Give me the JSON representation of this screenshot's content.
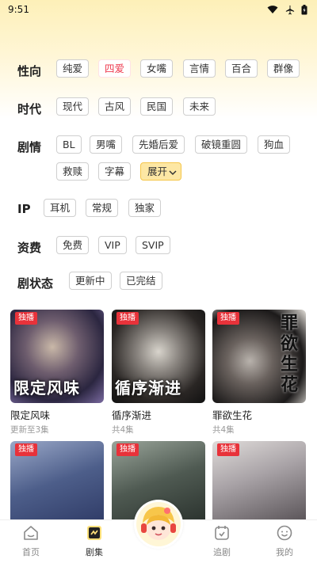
{
  "status_bar": {
    "time": "9:51"
  },
  "filters": {
    "gender": {
      "label": "性向",
      "options": [
        "纯爱",
        "四爱",
        "女嘴",
        "言情",
        "百合",
        "群像"
      ],
      "active": "四爱"
    },
    "era": {
      "label": "时代",
      "options": [
        "现代",
        "古风",
        "民国",
        "未来"
      ]
    },
    "plot": {
      "label": "剧情",
      "options": [
        "BL",
        "男嘴",
        "先婚后爱",
        "破镜重圆",
        "狗血",
        "救赎",
        "字幕"
      ],
      "expand_label": "展开"
    },
    "ip": {
      "label": "IP",
      "options": [
        "耳机",
        "常规",
        "独家"
      ]
    },
    "fee": {
      "label": "资费",
      "options": [
        "免费",
        "VIP",
        "SVIP"
      ]
    },
    "status": {
      "label": "剧状态",
      "options": [
        "更新中",
        "已完结"
      ]
    }
  },
  "cards": [
    {
      "badge": "独播",
      "poster_title": "限定风味",
      "title": "限定风味",
      "sub": "更新至3集"
    },
    {
      "badge": "独播",
      "poster_title": "循序渐进",
      "title": "循序渐进",
      "sub": "共4集"
    },
    {
      "badge": "独播",
      "poster_title": "罪欲生花",
      "title": "罪欲生花",
      "sub": "共4集"
    },
    {
      "badge": "独播"
    },
    {
      "badge": "独播"
    },
    {
      "badge": "独播"
    }
  ],
  "tabbar": {
    "items": [
      {
        "label": "首页",
        "icon": "home-icon"
      },
      {
        "label": "剧集",
        "icon": "drama-icon"
      },
      {
        "label": "",
        "icon": "mascot-icon"
      },
      {
        "label": "追剧",
        "icon": "follow-icon"
      },
      {
        "label": "我的",
        "icon": "profile-icon"
      }
    ],
    "active": "剧集"
  },
  "colors": {
    "accent_red": "#e8323a",
    "active_chip_text": "#ee3b4f",
    "expand_bg": "#fde7a4",
    "header_yellow": "#fdf0b8"
  }
}
